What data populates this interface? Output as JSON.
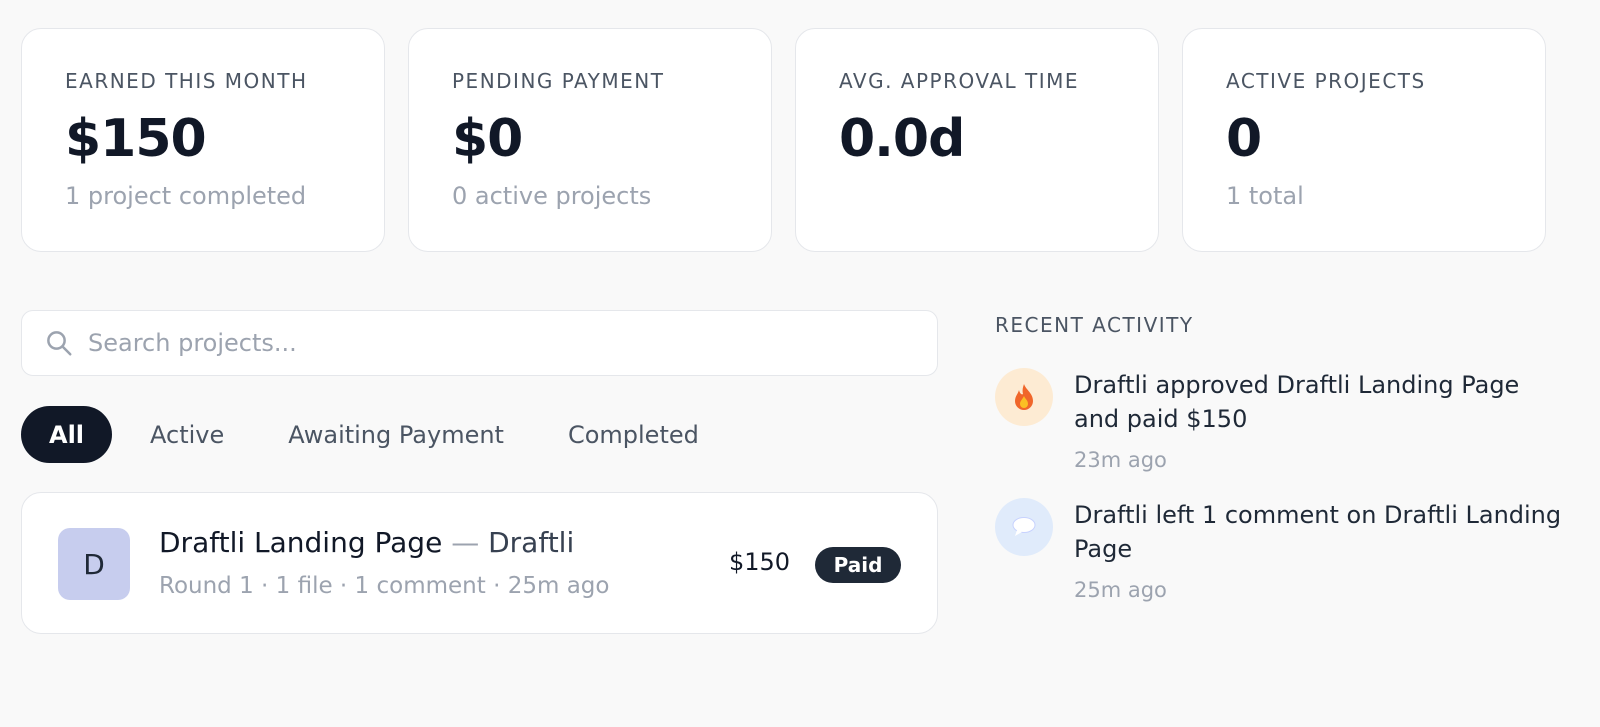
{
  "stats": [
    {
      "label": "EARNED THIS MONTH",
      "value": "$150",
      "sub": "1 project completed"
    },
    {
      "label": "PENDING PAYMENT",
      "value": "$0",
      "sub": "0 active projects"
    },
    {
      "label": "AVG. APPROVAL TIME",
      "value": "0.0d",
      "sub": ""
    },
    {
      "label": "ACTIVE PROJECTS",
      "value": "0",
      "sub": "1 total"
    }
  ],
  "search": {
    "placeholder": "Search projects...",
    "value": "",
    "icon": "search-icon"
  },
  "tabs": [
    {
      "label": "All",
      "active": true
    },
    {
      "label": "Active",
      "active": false
    },
    {
      "label": "Awaiting Payment",
      "active": false
    },
    {
      "label": "Completed",
      "active": false
    }
  ],
  "projects": [
    {
      "avatar": "D",
      "name": "Draftli Landing Page",
      "separator": "—",
      "client": "Draftli",
      "meta": "Round 1 · 1 file · 1 comment · 25m ago",
      "amount": "$150",
      "status": "Paid"
    }
  ],
  "activity": {
    "heading": "RECENT ACTIVITY",
    "items": [
      {
        "icon": "fire-icon",
        "text": "Draftli approved Draftli Landing Page and paid $150",
        "time": "23m ago",
        "bubble_color": "#fdebd3"
      },
      {
        "icon": "speech-bubble-icon",
        "text": "Draftli left 1 comment on Draftli Landing Page",
        "time": "25m ago",
        "bubble_color": "#e0ebfb"
      }
    ]
  },
  "colors": {
    "background": "#f9f9f9",
    "card": "#ffffff",
    "dark": "#111827",
    "muted": "#9ca3af",
    "avatar": "#c7cdee",
    "badge": "#1f2937"
  }
}
